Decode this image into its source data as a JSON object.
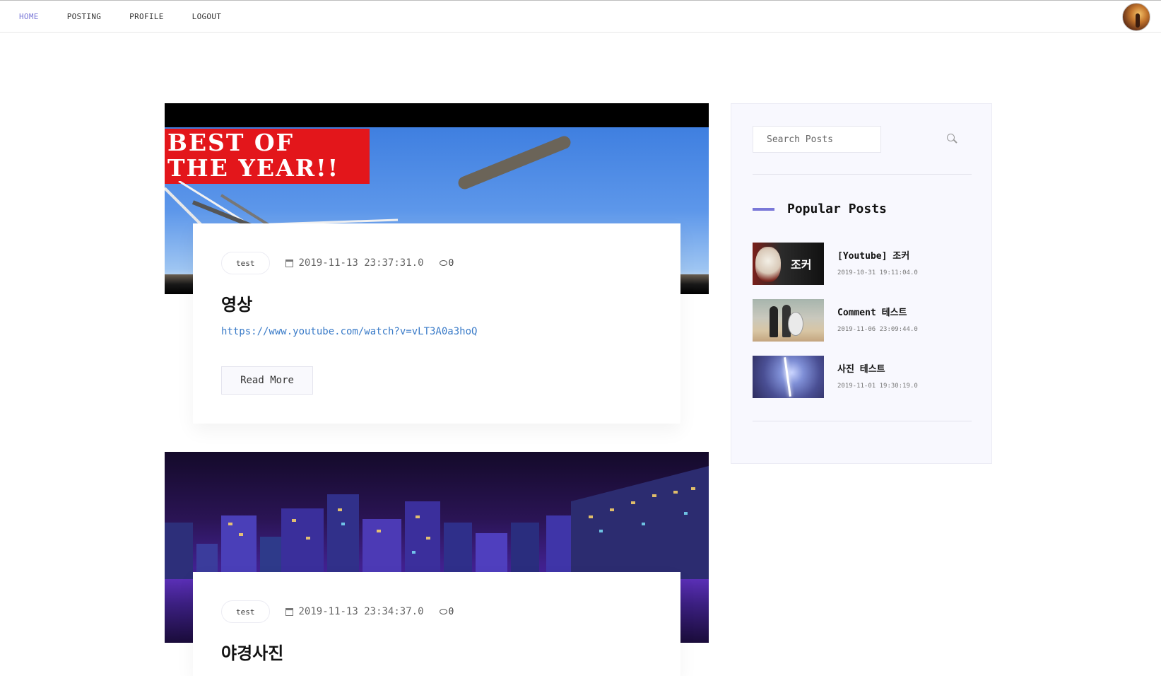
{
  "nav": {
    "items": [
      {
        "label": "HOME",
        "active": true
      },
      {
        "label": "POSTING",
        "active": false
      },
      {
        "label": "PROFILE",
        "active": false
      },
      {
        "label": "LOGOUT",
        "active": false
      }
    ]
  },
  "posts": [
    {
      "tag": "test",
      "date": "2019-11-13 23:37:31.0",
      "comments": "0",
      "title": "영상",
      "link": "https://www.youtube.com/watch?v=vLT3A0a3hoQ",
      "read_more": "Read More",
      "image": {
        "banner_line1": "BEST OF",
        "banner_line2": "THE YEAR!!"
      }
    },
    {
      "tag": "test",
      "date": "2019-11-13 23:34:37.0",
      "comments": "0",
      "title": "야경사진"
    }
  ],
  "sidebar": {
    "search_placeholder": "Search Posts",
    "popular_title": "Popular Posts",
    "popular": [
      {
        "title": "[Youtube] 조커",
        "date": "2019-10-31 19:11:04.0",
        "thumb_text": "조커"
      },
      {
        "title": "Comment 테스트",
        "date": "2019-11-06 23:09:44.0"
      },
      {
        "title": "사진 테스트",
        "date": "2019-11-01 19:30:19.0"
      }
    ]
  },
  "colors": {
    "accent": "#7a78d8",
    "link": "#3a7bc8"
  }
}
